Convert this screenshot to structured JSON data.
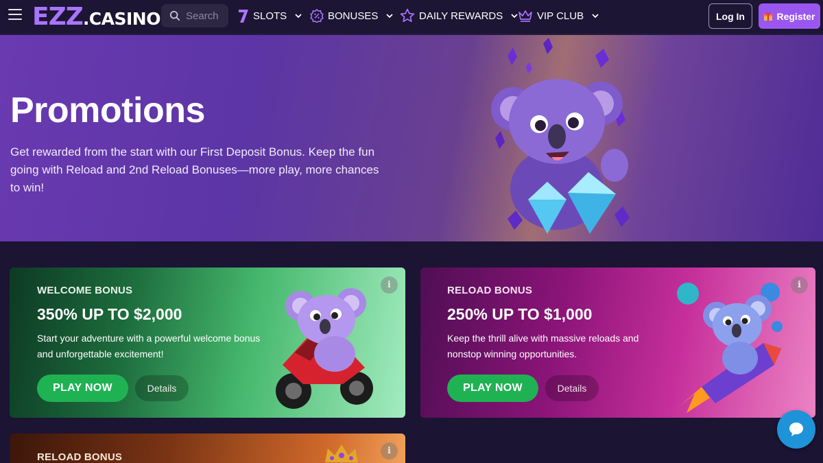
{
  "header": {
    "logo_ezz": "EZZ",
    "logo_casino": ".CASINO",
    "search_placeholder": "Search",
    "nav": [
      {
        "label": "SLOTS",
        "icon": "seven-icon"
      },
      {
        "label": "BONUSES",
        "icon": "percent-badge-icon"
      },
      {
        "label": "DAILY REWARDS",
        "icon": "star-icon"
      },
      {
        "label": "VIP CLUB",
        "icon": "crown-icon"
      }
    ],
    "login_label": "Log In",
    "register_label": "Register"
  },
  "hero": {
    "title": "Promotions",
    "description": "Get rewarded from the start with our First Deposit Bonus. Keep the fun going with Reload and 2nd Reload Bonuses—more play, more chances to win!"
  },
  "cards": [
    {
      "label": "WELCOME BONUS",
      "title": "350% UP TO $2,000",
      "description": "Start your adventure with a powerful welcome bonus and unforgettable excitement!",
      "play_label": "PLAY NOW",
      "details_label": "Details",
      "info_symbol": "i"
    },
    {
      "label": "RELOAD BONUS",
      "title": "250% UP TO $1,000",
      "description": "Keep the thrill alive with massive reloads and nonstop winning opportunities.",
      "play_label": "PLAY NOW",
      "details_label": "Details",
      "info_symbol": "i"
    },
    {
      "label": "RELOAD BONUS",
      "info_symbol": "i"
    }
  ],
  "colors": {
    "brand_purple": "#a974ff",
    "register_purple": "#9a57ef",
    "play_green": "#1fb253",
    "chat_blue": "#1f93d7"
  }
}
